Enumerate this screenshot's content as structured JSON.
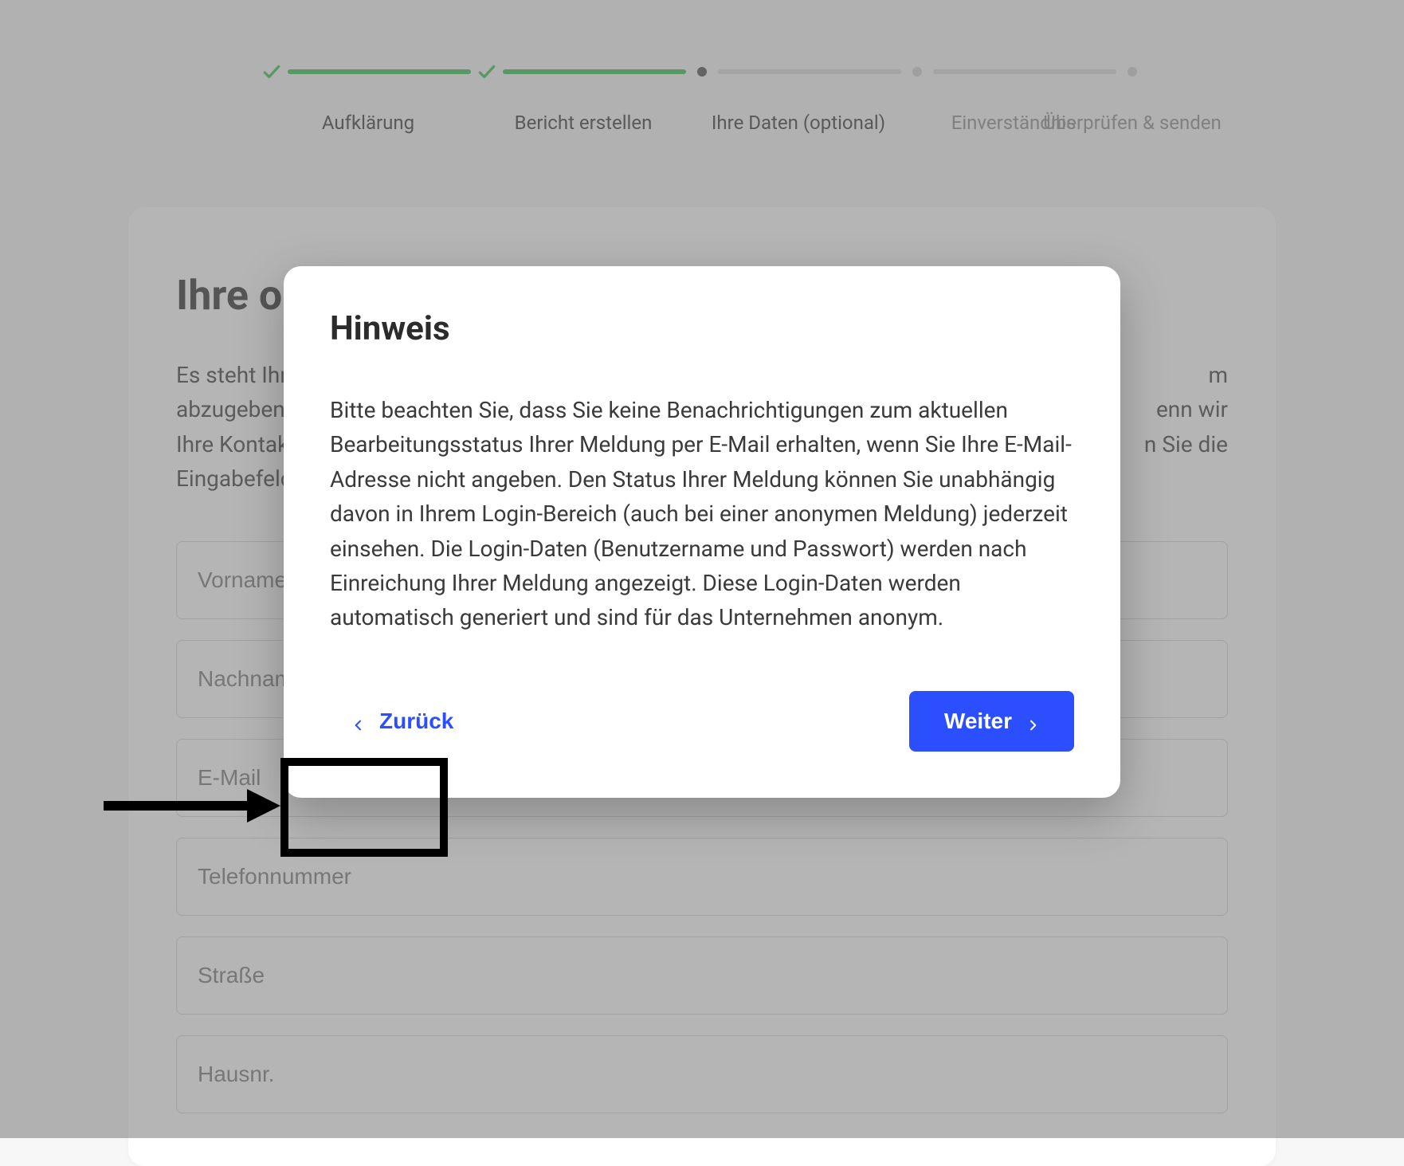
{
  "stepper": {
    "steps": [
      {
        "label": "Aufklärung",
        "state": "done"
      },
      {
        "label": "Bericht erstellen",
        "state": "done"
      },
      {
        "label": "Ihre Daten (optional)",
        "state": "current"
      },
      {
        "label": "Einverständnis",
        "state": "future"
      },
      {
        "label": "Überprüfen & senden",
        "state": "future"
      }
    ]
  },
  "card": {
    "heading_partial": "Ihre op",
    "intro_partial_lines": [
      "Es steht Ihn",
      "abzugeben.",
      "Ihre Kontakt",
      "Eingabefeld"
    ],
    "intro_right_fragments": [
      "m",
      "enn wir",
      "n Sie die"
    ]
  },
  "fields": [
    {
      "name": "vorname",
      "placeholder": "Vorname"
    },
    {
      "name": "nachname",
      "placeholder": "Nachname"
    },
    {
      "name": "email",
      "placeholder": "E-Mail"
    },
    {
      "name": "telefonnummer",
      "placeholder": "Telefonnummer"
    },
    {
      "name": "strasse",
      "placeholder": "Straße"
    },
    {
      "name": "hausnr",
      "placeholder": "Hausnr."
    }
  ],
  "modal": {
    "title": "Hinweis",
    "body": "Bitte beachten Sie, dass Sie keine Benachrichtigungen zum aktuellen Bearbeitungsstatus Ihrer Meldung per E-Mail erhalten, wenn Sie Ihre E-Mail-Adresse nicht angeben. Den Status Ihrer Meldung können Sie unabhängig davon in Ihrem Login-Bereich (auch bei einer anonymen Meldung) jederzeit einsehen. Die Login-Daten (Benutzername und Passwort) werden nach Einreichung Ihrer Meldung angezeigt. Diese Login-Daten werden automatisch generiert und sind für das Unternehmen anonym.",
    "back_label": "Zurück",
    "next_label": "Weiter"
  },
  "colors": {
    "accent_green": "#2fbf4a",
    "accent_blue": "#2b4eff"
  },
  "annotation": {
    "highlight_target": "back-button"
  }
}
